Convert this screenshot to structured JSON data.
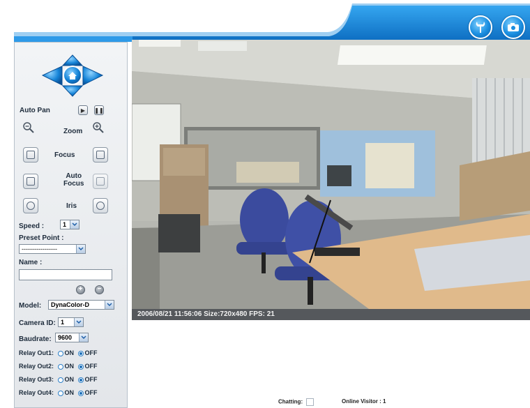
{
  "toolbar": {
    "settings_icon": "wrench-icon",
    "snapshot_icon": "camera-icon",
    "accent": "#1a8ee0"
  },
  "ptz": {
    "directional_pad_icon": "direction-pad-icon",
    "auto_pan_label": "Auto Pan",
    "zoom_label": "Zoom",
    "focus_label": "Focus",
    "auto_focus_label": "Auto\nFocus",
    "iris_label": "Iris"
  },
  "speed": {
    "label": "Speed :",
    "value": "1"
  },
  "preset": {
    "label": "Preset Point :",
    "value": "-----------------"
  },
  "name": {
    "label": "Name :",
    "value": ""
  },
  "model": {
    "label": "Model:",
    "value": "DynaColor-D"
  },
  "camera_id": {
    "label": "Camera ID:",
    "value": "1"
  },
  "baudrate": {
    "label": "Baudrate:",
    "value": "9600"
  },
  "relays": [
    {
      "label": "Relay Out1:",
      "on": "ON",
      "off": "OFF",
      "selected": "OFF"
    },
    {
      "label": "Relay Out2:",
      "on": "ON",
      "off": "OFF",
      "selected": "OFF"
    },
    {
      "label": "Relay Out3:",
      "on": "ON",
      "off": "OFF",
      "selected": "OFF"
    },
    {
      "label": "Relay Out4:",
      "on": "ON",
      "off": "OFF",
      "selected": "OFF"
    }
  ],
  "video": {
    "status": "2006/08/21 11:56:06 Size:720x480 FPS: 21"
  },
  "footer": {
    "chatting_label": "Chatting:",
    "visitor_label": "Online Visitor : 1"
  }
}
